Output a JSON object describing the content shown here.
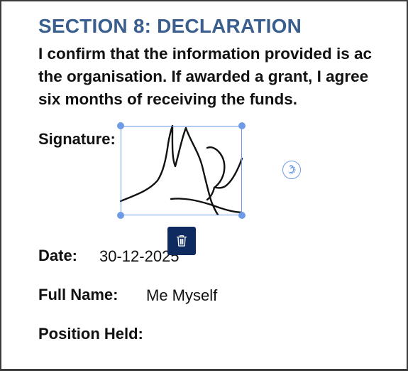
{
  "section": {
    "heading": "SECTION 8: DECLARATION",
    "paragraph_lines": [
      "I confirm that the information provided is ac",
      "the organisation. If awarded a grant, I agree",
      "six months of receiving the funds."
    ]
  },
  "fields": {
    "signature_label": "Signature:",
    "date_label": "Date:",
    "date_value": "30-12-2025",
    "full_name_label": "Full Name:",
    "full_name_value": "Me Myself",
    "position_label": "Position Held:"
  },
  "signature_controls": {
    "rotate_icon": "rotate-icon",
    "delete_icon": "trash-icon"
  },
  "colors": {
    "heading": "#3a5f8f",
    "selection": "#6f9ae8",
    "delete_button": "#0f2a5e"
  }
}
